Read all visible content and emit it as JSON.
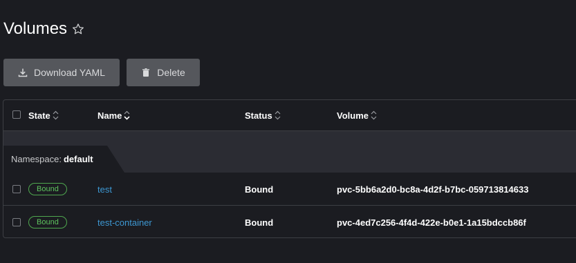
{
  "header": {
    "title": "Volumes",
    "favorite_icon": "star-icon"
  },
  "actions": {
    "download_label": "Download YAML",
    "delete_label": "Delete"
  },
  "table": {
    "columns": {
      "state": "State",
      "name": "Name",
      "status": "Status",
      "volume": "Volume"
    },
    "group": {
      "label": "Namespace:",
      "value": "default"
    },
    "rows": [
      {
        "state": "Bound",
        "name": "test",
        "status": "Bound",
        "volume": "pvc-5bb6a2d0-bc8a-4d2f-b7bc-059713814633"
      },
      {
        "state": "Bound",
        "name": "test-container",
        "status": "Bound",
        "volume": "pvc-4ed7c256-4f4d-422e-b0e1-1a15bdccb86f"
      }
    ]
  },
  "colors": {
    "background": "#1b1c21",
    "button": "#55575c",
    "link": "#3d98d3",
    "badge_green": "#5ec35e",
    "group_band": "#2b2c33"
  }
}
